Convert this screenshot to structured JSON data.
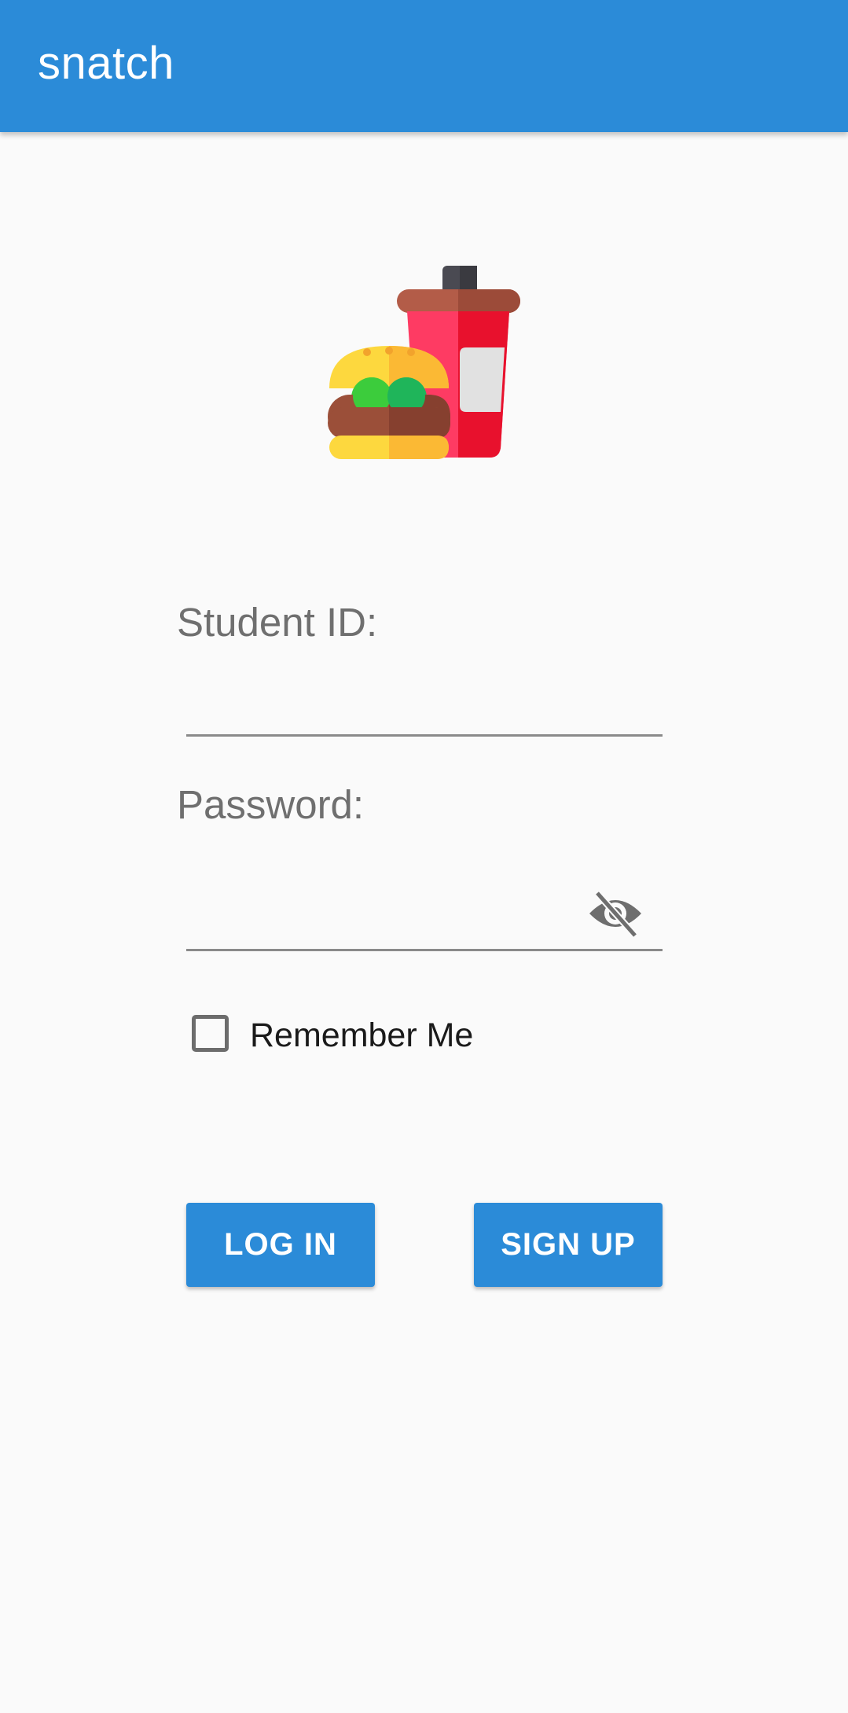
{
  "appbar": {
    "title": "snatch",
    "color": "#2b8bd8"
  },
  "logo": {
    "icon": "burger-and-drink-icon"
  },
  "form": {
    "student_id_label": "Student ID:",
    "student_id_value": "",
    "password_label": "Password:",
    "password_value": "",
    "password_toggle_icon": "eye-off-icon",
    "remember_me_label": "Remember Me",
    "remember_me_checked": false
  },
  "actions": {
    "login_label": "LOG IN",
    "signup_label": "SIGN UP"
  }
}
